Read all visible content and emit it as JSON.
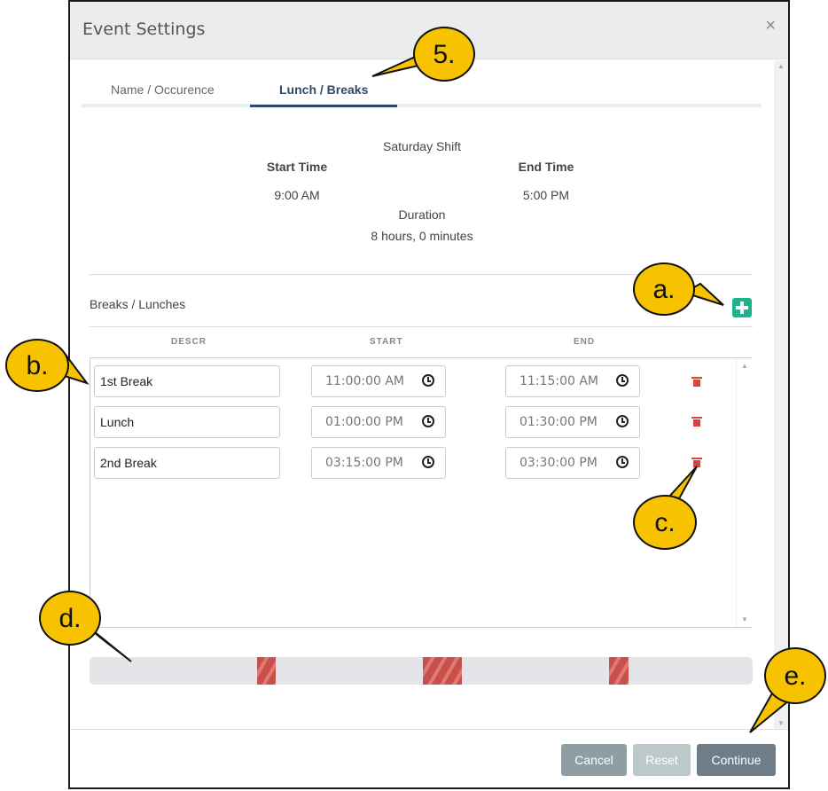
{
  "dialog": {
    "title": "Event Settings",
    "close_glyph": "×"
  },
  "tabs": [
    {
      "label": "Name / Occurence",
      "active": false
    },
    {
      "label": "Lunch / Breaks",
      "active": true
    }
  ],
  "shift": {
    "name": "Saturday Shift",
    "start_label": "Start Time",
    "start_value": "9:00 AM",
    "end_label": "End Time",
    "end_value": "5:00 PM",
    "duration_label": "Duration",
    "duration_value": "8 hours, 0 minutes"
  },
  "breaks": {
    "section_title": "Breaks / Lunches",
    "add_icon": "plus-icon",
    "columns": [
      "DESCR",
      "START",
      "END"
    ],
    "rows": [
      {
        "descr": "1st Break",
        "start": "11:00:00 AM",
        "end": "11:15:00 AM"
      },
      {
        "descr": "Lunch",
        "start": "01:00:00 PM",
        "end": "01:30:00 PM"
      },
      {
        "descr": "2nd Break",
        "start": "03:15:00 PM",
        "end": "03:30:00 PM"
      }
    ]
  },
  "footer": {
    "cancel": "Cancel",
    "reset": "Reset",
    "continue": "Continue"
  },
  "callouts": {
    "tab": "5.",
    "add": "a.",
    "descr": "b.",
    "delete": "c.",
    "timeline": "d.",
    "continue": "e."
  },
  "colors": {
    "accent": "#2f4a66",
    "add": "#1fb38a",
    "delete": "#d9453b",
    "callout": "#f7c200"
  }
}
